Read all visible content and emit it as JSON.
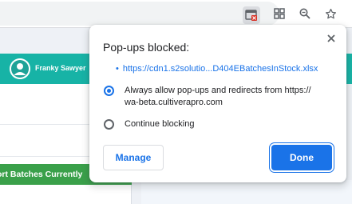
{
  "toolbar": {
    "icons": [
      "popup-blocked-icon",
      "apps-grid-icon",
      "zoom-icon",
      "bookmark-star-icon"
    ]
  },
  "app": {
    "user_name": "Franky Sawyer",
    "export_button": "ort Batches Currently"
  },
  "popup": {
    "title": "Pop-ups blocked:",
    "blocked_link": "https://cdn1.s2solutio...D404EBatchesInStock.xlsx",
    "options": [
      {
        "label": "Always allow pop-ups and redirects from https://\nwa-beta.cultiverapro.com",
        "selected": true
      },
      {
        "label": "Continue blocking",
        "selected": false
      }
    ],
    "manage_label": "Manage",
    "done_label": "Done"
  },
  "colors": {
    "accent": "#1a73e8",
    "header": "#17b3a6",
    "export_green": "#3aa04a"
  }
}
